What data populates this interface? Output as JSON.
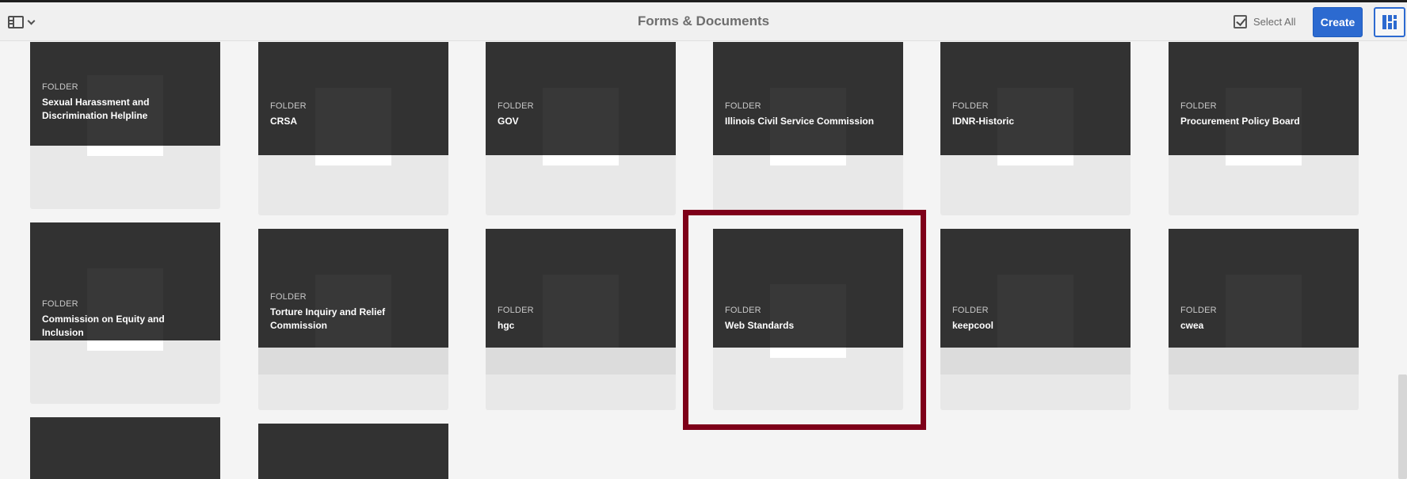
{
  "toolbar": {
    "title": "Forms & Documents",
    "select_all_label": "Select All",
    "create_label": "Create",
    "rail_icon": "rail-toggle-icon",
    "view_icon": "card-view-icon",
    "accent_color": "#2c6ad0"
  },
  "cards": [
    {
      "type": "FOLDER",
      "name": "Sexual Harassment and Discrimination Helpline"
    },
    {
      "type": "FOLDER",
      "name": "CRSA"
    },
    {
      "type": "FOLDER",
      "name": "GOV"
    },
    {
      "type": "FOLDER",
      "name": "Illinois Civil Service Commission"
    },
    {
      "type": "FOLDER",
      "name": "IDNR-Historic"
    },
    {
      "type": "FOLDER",
      "name": "Procurement Policy Board"
    },
    {
      "type": "FOLDER",
      "name": "Commission on Equity and Inclusion"
    },
    {
      "type": "FOLDER",
      "name": "Torture Inquiry and Relief Commission"
    },
    {
      "type": "FOLDER",
      "name": "hgc"
    },
    {
      "type": "FOLDER",
      "name": "Web Standards"
    },
    {
      "type": "FOLDER",
      "name": "keepcool"
    },
    {
      "type": "FOLDER",
      "name": "cwea"
    }
  ],
  "highlight_color": "#7e0019"
}
